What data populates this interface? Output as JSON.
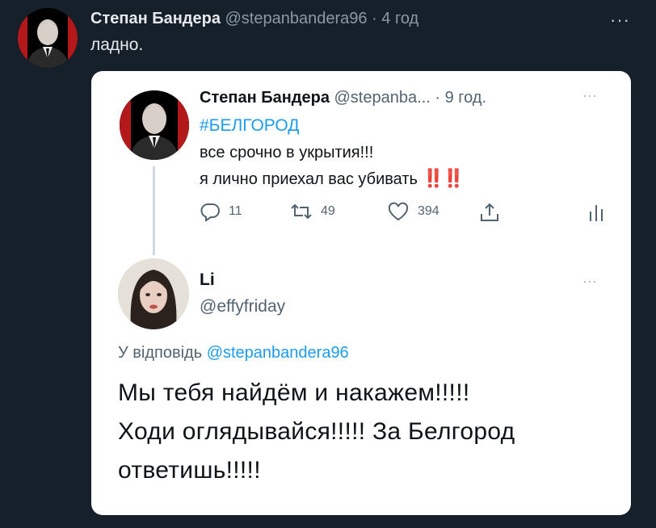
{
  "outer_tweet": {
    "name": "Степан Бандера",
    "handle": "@stepanbandera96",
    "separator": "·",
    "time": "4 год",
    "more": "···",
    "text": "ладно."
  },
  "quoted_tweet": {
    "name": "Степан Бандера",
    "handle": "@stepanba...",
    "separator": "·",
    "time": "9 год.",
    "more": "···",
    "hashtag": "#БЕЛГОРОД",
    "line1": "все срочно в укрытия!!!",
    "line2": "я лично приехал вас убивать",
    "emphasis": "‼️‼️",
    "actions": {
      "reply_count": "11",
      "retweet_count": "49",
      "like_count": "394"
    }
  },
  "reply_tweet": {
    "name": "Li",
    "handle": "@effyfriday",
    "more": "···",
    "reply_prefix": "У відповідь",
    "reply_handle": "@stepanbandera96",
    "line1": "Мы тебя найдём и накажем!!!!!",
    "line2": "Ходи оглядывайся!!!!! За Белгород",
    "line3": "ответишь!!!!!"
  },
  "colors": {
    "background": "#15202b",
    "accent": "#1d9bf0",
    "text_dark": "#0f1419",
    "text_muted": "#536471",
    "alert": "#e0245e"
  }
}
